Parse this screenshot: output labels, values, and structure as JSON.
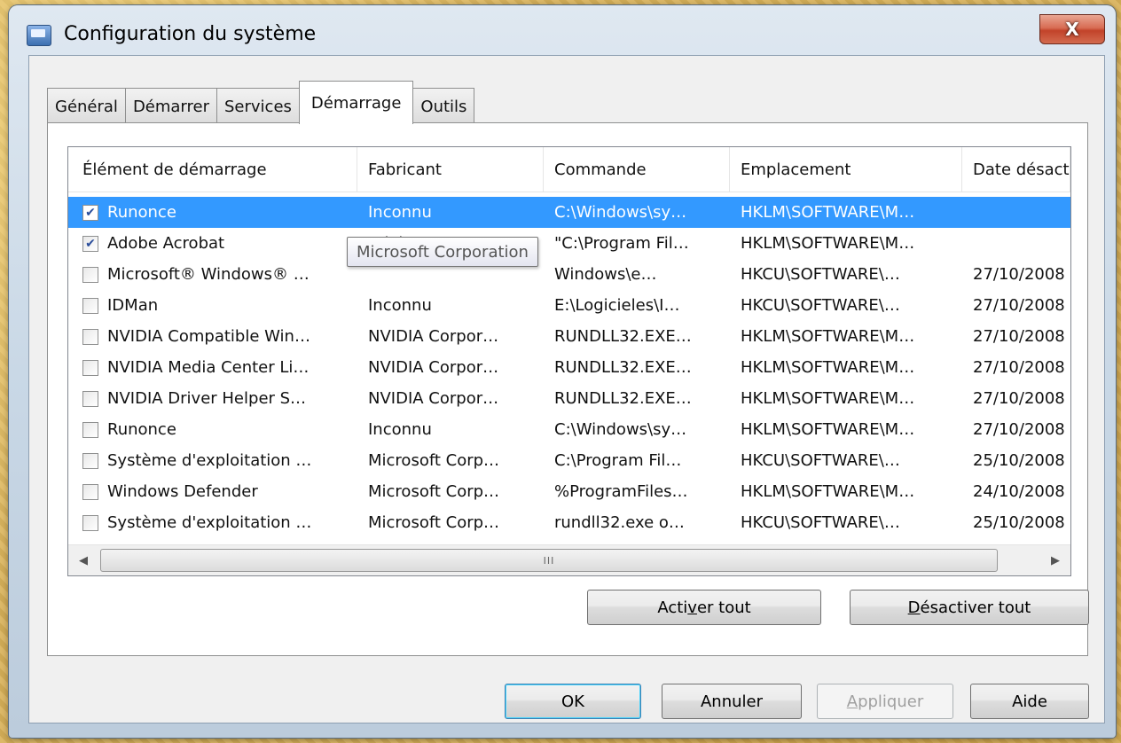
{
  "window": {
    "title": "Configuration du système",
    "close_label": "X"
  },
  "tabs": [
    {
      "label": "Général",
      "active": false
    },
    {
      "label": "Démarrer",
      "active": false
    },
    {
      "label": "Services",
      "active": false
    },
    {
      "label": "Démarrage",
      "active": true
    },
    {
      "label": "Outils",
      "active": false
    }
  ],
  "table": {
    "columns": [
      "Élément de démarrage",
      "Fabricant",
      "Commande",
      "Emplacement",
      "Date désact"
    ],
    "rows": [
      {
        "checked": true,
        "selected": true,
        "cells": [
          "Runonce",
          "Inconnu",
          "C:\\Windows\\sy…",
          "HKLM\\SOFTWARE\\M…",
          ""
        ]
      },
      {
        "checked": true,
        "selected": false,
        "cells": [
          "Adobe Acrobat",
          "Adobe System…",
          "\"C:\\Program Fil…",
          "HKLM\\SOFTWARE\\M…",
          ""
        ]
      },
      {
        "checked": false,
        "selected": false,
        "cells": [
          "Microsoft® Windows® …",
          "",
          "Windows\\e…",
          "HKCU\\SOFTWARE\\…",
          "27/10/2008"
        ]
      },
      {
        "checked": false,
        "selected": false,
        "cells": [
          "IDMan",
          "Inconnu",
          "E:\\Logicieles\\I…",
          "HKCU\\SOFTWARE\\…",
          "27/10/2008"
        ]
      },
      {
        "checked": false,
        "selected": false,
        "cells": [
          "NVIDIA Compatible Win…",
          "NVIDIA Corpor…",
          "RUNDLL32.EXE…",
          "HKLM\\SOFTWARE\\M…",
          "27/10/2008"
        ]
      },
      {
        "checked": false,
        "selected": false,
        "cells": [
          "NVIDIA Media Center Li…",
          "NVIDIA Corpor…",
          "RUNDLL32.EXE…",
          "HKLM\\SOFTWARE\\M…",
          "27/10/2008"
        ]
      },
      {
        "checked": false,
        "selected": false,
        "cells": [
          "NVIDIA Driver Helper S…",
          "NVIDIA Corpor…",
          "RUNDLL32.EXE…",
          "HKLM\\SOFTWARE\\M…",
          "27/10/2008"
        ]
      },
      {
        "checked": false,
        "selected": false,
        "cells": [
          "Runonce",
          "Inconnu",
          "C:\\Windows\\sy…",
          "HKLM\\SOFTWARE\\M…",
          "27/10/2008"
        ]
      },
      {
        "checked": false,
        "selected": false,
        "cells": [
          "Système d'exploitation …",
          "Microsoft Corp…",
          "C:\\Program Fil…",
          "HKCU\\SOFTWARE\\…",
          "25/10/2008"
        ]
      },
      {
        "checked": false,
        "selected": false,
        "cells": [
          "Windows Defender",
          "Microsoft Corp…",
          "%ProgramFiles…",
          "HKLM\\SOFTWARE\\M…",
          "24/10/2008"
        ]
      },
      {
        "checked": false,
        "selected": false,
        "cells": [
          "Système d'exploitation …",
          "Microsoft Corp…",
          "rundll32.exe o…",
          "HKCU\\SOFTWARE\\…",
          "25/10/2008"
        ]
      }
    ]
  },
  "tooltip": "Microsoft Corporation",
  "scrollbar": {
    "left_arrow": "◀",
    "right_arrow": "▶",
    "grip": "III"
  },
  "buttons": {
    "enable_all_pre": "Acti",
    "enable_all_key": "v",
    "enable_all_post": "er tout",
    "disable_all_key": "D",
    "disable_all_post": "ésactiver tout",
    "ok": "OK",
    "cancel": "Annuler",
    "apply_key": "A",
    "apply_post": "ppliquer",
    "help": "Aide"
  },
  "colors": {
    "selection": "#3399ff",
    "close_button": "#c2432a"
  }
}
